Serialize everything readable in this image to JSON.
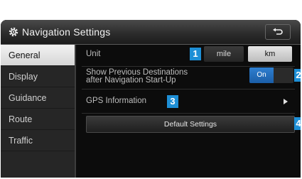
{
  "header": {
    "title": "Navigation Settings"
  },
  "sidebar": {
    "items": [
      {
        "label": "General"
      },
      {
        "label": "Display"
      },
      {
        "label": "Guidance"
      },
      {
        "label": "Route"
      },
      {
        "label": "Traffic"
      }
    ]
  },
  "settings": {
    "unit": {
      "label": "Unit",
      "options": [
        "mile",
        "km"
      ],
      "selected": "km"
    },
    "show_previous": {
      "label_line1": "Show Previous Destinations",
      "label_line2": "after Navigation Start-Up",
      "toggle_label": "On",
      "value": "On"
    },
    "gps": {
      "label": "GPS Information"
    },
    "default_button": {
      "label": "Default Settings"
    }
  },
  "callouts": [
    "1",
    "2",
    "3",
    "4"
  ],
  "colors": {
    "accent": "#1e8fd6",
    "active_toggle": "#2f7fd0"
  }
}
